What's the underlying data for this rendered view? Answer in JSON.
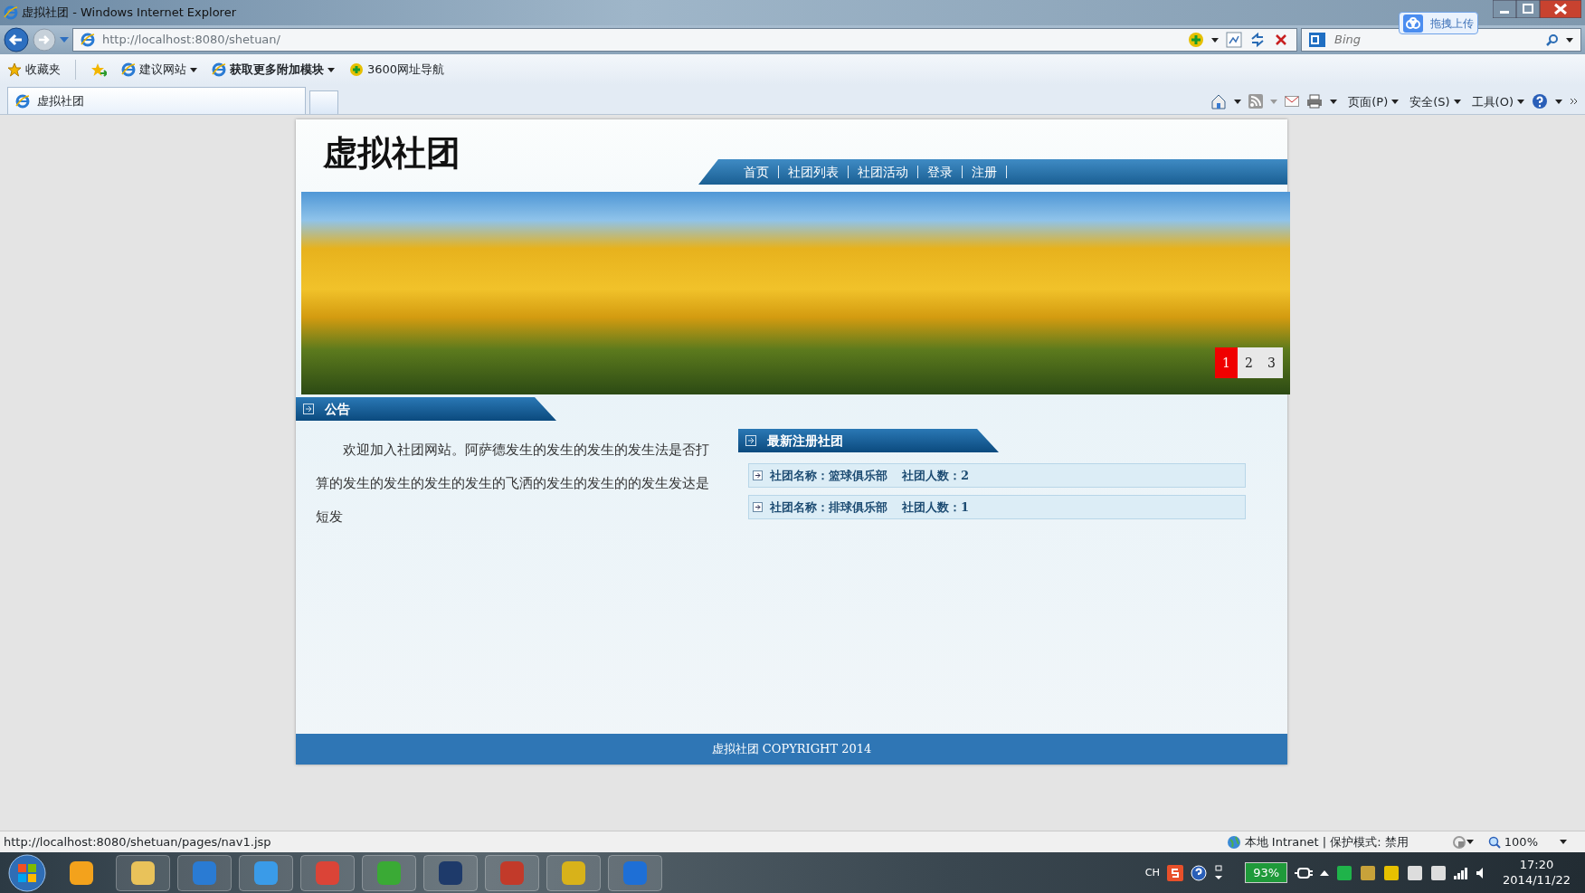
{
  "window": {
    "title": "虚拟社团 - Windows Internet Explorer"
  },
  "address_bar": {
    "url": "http://localhost:8080/shetuan/"
  },
  "search": {
    "placeholder": "Bing"
  },
  "upload_button": {
    "label": "拖拽上传"
  },
  "favorites_bar": {
    "items": [
      {
        "label": "收藏夹",
        "bold": false,
        "dropdown": false
      },
      {
        "label": "建议网站",
        "bold": false,
        "dropdown": true
      },
      {
        "label": "获取更多附加模块",
        "bold": true,
        "dropdown": true
      },
      {
        "label": "3600网址导航",
        "bold": false,
        "dropdown": false
      }
    ]
  },
  "tabs": [
    {
      "label": "虚拟社团",
      "selected": true
    }
  ],
  "command_bar": {
    "items": [
      {
        "label": "页面(P)"
      },
      {
        "label": "安全(S)"
      },
      {
        "label": "工具(O)"
      }
    ]
  },
  "page": {
    "site_title": "虚拟社团",
    "nav": [
      {
        "label": "首页"
      },
      {
        "label": "社团列表"
      },
      {
        "label": "社团活动"
      },
      {
        "label": "登录"
      },
      {
        "label": "注册"
      }
    ],
    "slider": [
      {
        "label": "1",
        "selected": true
      },
      {
        "label": "2",
        "selected": false
      },
      {
        "label": "3",
        "selected": false
      }
    ],
    "notice": {
      "title": "公告",
      "text": "欢迎加入社团网站。阿萨德发生的发生的发生的发生法是否打算的发生的发生的发生的发生的飞洒的发生的发生的的发生发达是短发"
    },
    "latest": {
      "title": "最新注册社团",
      "rows": [
        {
          "name": "社团名称：篮球俱乐部",
          "count": "社团人数：2"
        },
        {
          "name": "社团名称：排球俱乐部",
          "count": "社团人数：1"
        }
      ]
    },
    "footer": "虚拟社团 COPYRIGHT 2014"
  },
  "status_bar": {
    "url": "http://localhost:8080/shetuan/pages/nav1.jsp",
    "zone": "本地 Intranet | 保护模式: 禁用",
    "zoom": "100%"
  },
  "taskbar": {
    "language": "CH",
    "battery": "93%",
    "time": "17:20",
    "date": "2014/11/22"
  }
}
